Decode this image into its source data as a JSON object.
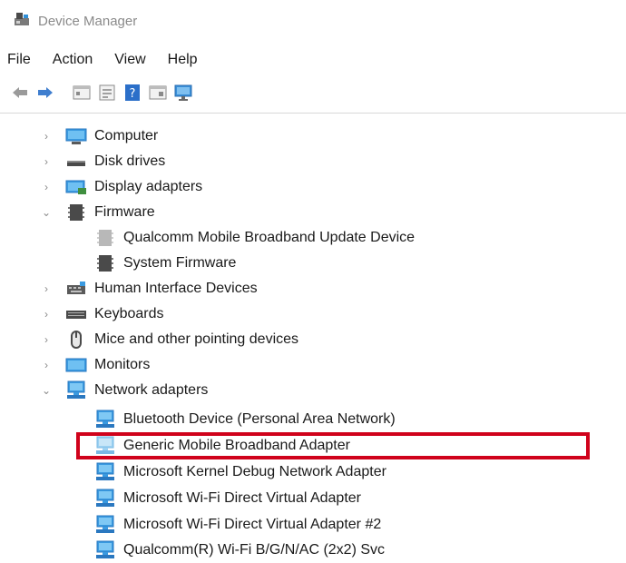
{
  "window": {
    "title": "Device Manager"
  },
  "menu": [
    "File",
    "Action",
    "View",
    "Help"
  ],
  "tree": {
    "computer": "Computer",
    "disk_drives": "Disk drives",
    "display_adapters": "Display adapters",
    "firmware": "Firmware",
    "firmware_children": [
      "Qualcomm Mobile Broadband Update Device",
      "System Firmware"
    ],
    "hid": "Human Interface Devices",
    "keyboards": "Keyboards",
    "mice": "Mice and other pointing devices",
    "monitors": "Monitors",
    "network_adapters": "Network adapters",
    "network_children": [
      "Bluetooth Device (Personal Area Network)",
      "Generic Mobile Broadband Adapter",
      "Microsoft Kernel Debug Network Adapter",
      "Microsoft Wi-Fi Direct Virtual Adapter",
      "Microsoft Wi-Fi Direct Virtual Adapter #2",
      "Qualcomm(R) Wi-Fi B/G/N/AC (2x2) Svc"
    ]
  },
  "colors": {
    "highlight": "#d0021b",
    "accent": "#2b7fd4"
  }
}
